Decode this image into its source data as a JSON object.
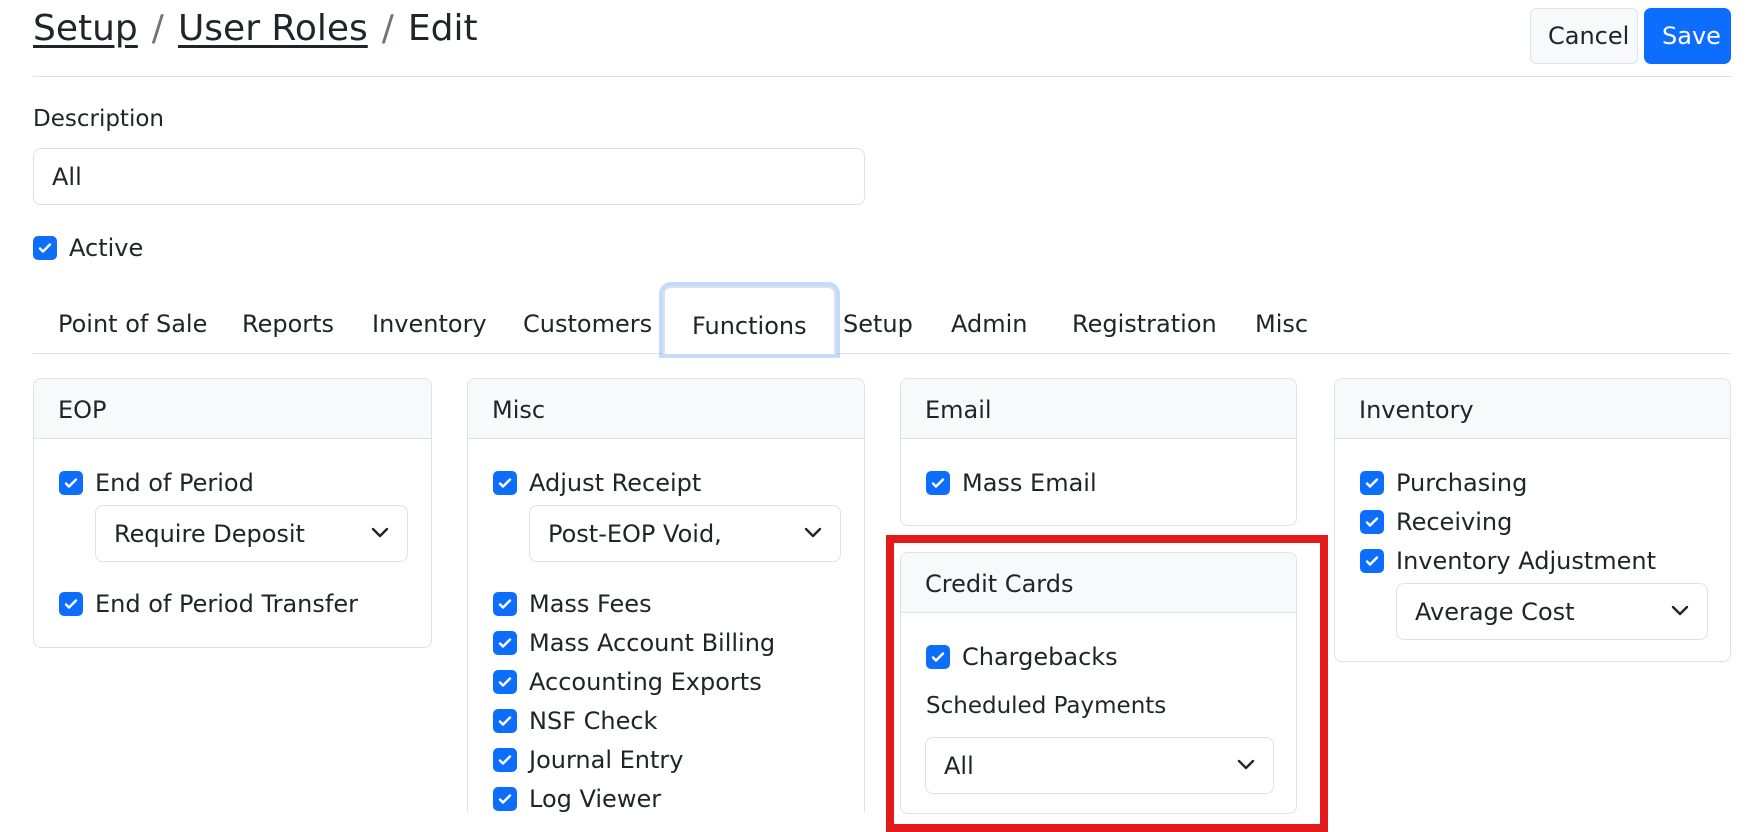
{
  "breadcrumb": {
    "item1": "Setup",
    "item2": "User Roles",
    "current": "Edit",
    "separator": "/"
  },
  "toolbar": {
    "cancel_label": "Cancel",
    "save_label": "Save"
  },
  "description": {
    "label": "Description",
    "value": "All"
  },
  "active": {
    "label": "Active",
    "checked": true
  },
  "tabs": [
    "Point of Sale",
    "Reports",
    "Inventory",
    "Customers",
    "Functions",
    "Setup",
    "Admin",
    "Registration",
    "Misc"
  ],
  "active_tab": "Functions",
  "cards": {
    "eop": {
      "title": "EOP",
      "end_of_period": "End of Period",
      "end_of_period_select": "Require Deposit",
      "end_of_period_transfer": "End of Period Transfer"
    },
    "misc": {
      "title": "Misc",
      "adjust_receipt": "Adjust Receipt",
      "adjust_receipt_select": "Post-EOP Void,",
      "items": [
        "Mass Fees",
        "Mass Account Billing",
        "Accounting Exports",
        "NSF Check",
        "Journal Entry",
        "Log Viewer"
      ]
    },
    "email": {
      "title": "Email",
      "mass_email": "Mass Email"
    },
    "credit_cards": {
      "title": "Credit Cards",
      "chargebacks": "Chargebacks",
      "scheduled_payments_label": "Scheduled Payments",
      "scheduled_payments_select": "All"
    },
    "inventory": {
      "title": "Inventory",
      "purchasing": "Purchasing",
      "receiving": "Receiving",
      "inventory_adjustment": "Inventory Adjustment",
      "inventory_adjustment_select": "Average Cost"
    }
  },
  "colors": {
    "primary": "#0d6efd",
    "highlight": "#e31b1b",
    "border": "#dee2e6",
    "card_header_bg": "#f8f9fa"
  }
}
